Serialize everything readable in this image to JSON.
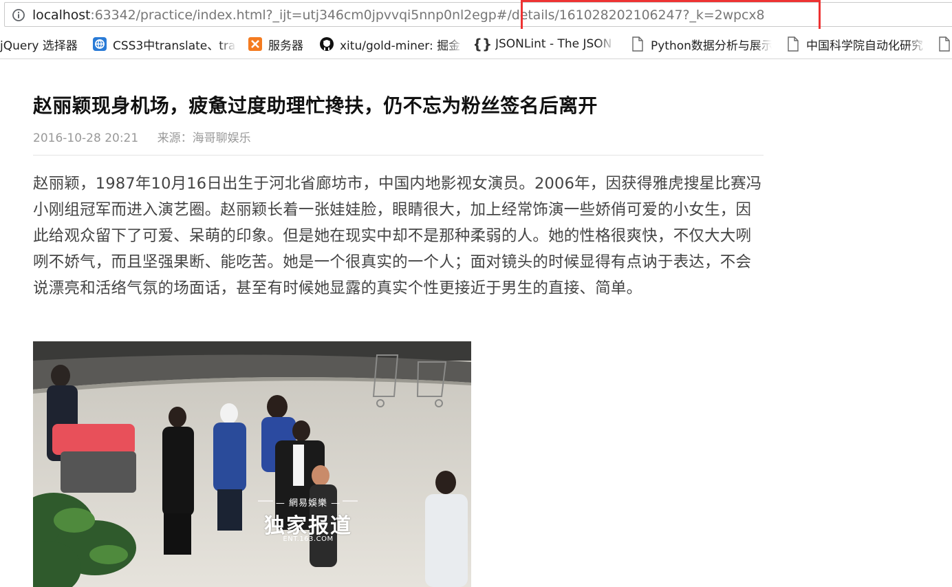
{
  "browser": {
    "url_host": "localhost",
    "url_rest": ":63342/practice/index.html?_ijt=utj346cm0jpvvqi5nnp0nl2egp#/details/161028202106247?_k=2wpcx8",
    "bookmarks": [
      {
        "label": "jQuery 选择器",
        "icon": "none"
      },
      {
        "label": "CSS3中translate、tra",
        "icon": "globe-blue-icon",
        "color": "#2a7bd6"
      },
      {
        "label": "服务器",
        "icon": "xampp-orange-icon",
        "color": "#f47b20"
      },
      {
        "label": "xitu/gold-miner: 掘金",
        "icon": "github-icon",
        "color": "#111111"
      },
      {
        "label": "JSONLint - The JSON",
        "icon": "braces-icon",
        "color": "#333333"
      },
      {
        "label": "Python数据分析与展示",
        "icon": "page-icon",
        "color": "#555555"
      },
      {
        "label": "中国科学院自动化研究",
        "icon": "page-icon",
        "color": "#555555"
      },
      {
        "label": "",
        "icon": "page-icon",
        "color": "#555555"
      }
    ]
  },
  "article": {
    "title": "赵丽颖现身机场，疲惫过度助理忙搀扶，仍不忘为粉丝签名后离开",
    "date": "2016-10-28 20:21",
    "source": "来源：海哥聊娱乐",
    "body": "赵丽颖，1987年10月16日出生于河北省廊坊市，中国内地影视女演员。2006年，因获得雅虎搜星比赛冯小刚组冠军而进入演艺圈。赵丽颖长着一张娃娃脸，眼睛很大，加上经常饰演一些娇俏可爱的小女生，因此给观众留下了可爱、呆萌的印象。但是她在现实中却不是那种柔弱的人。她的性格很爽快，不仅大大咧咧不娇气，而且坚强果断、能吃苦。她是一个很真实的一个人；面对镜头的时候显得有点讷于表达，不会说漂亮和活络气氛的场面话，甚至有时候她显露的真实个性更接近于男生的直接、简单。",
    "photo": {
      "watermark_brand": "— 網易娛樂 —",
      "watermark_main": "独家报道",
      "watermark_sub": "ENT.163.COM"
    }
  },
  "colors": {
    "highlight": "#ee3232",
    "meta_text": "#999999",
    "body_text": "#444444"
  }
}
